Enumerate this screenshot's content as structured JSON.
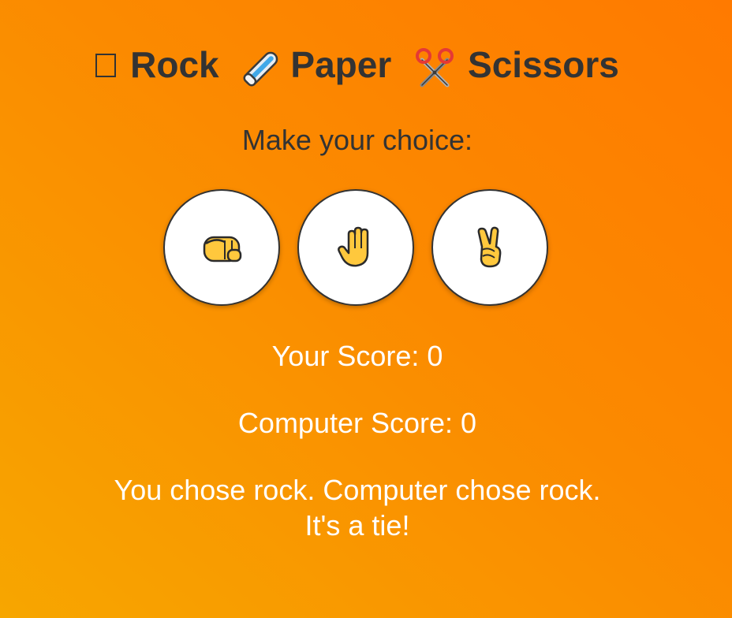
{
  "title": {
    "rock_label": "Rock",
    "paper_label": "Paper",
    "scissors_label": "Scissors",
    "rock_icon": "missing-glyph-box",
    "paper_icon": "paper-roll-icon",
    "scissors_icon": "scissors-icon"
  },
  "prompt": "Make your choice:",
  "choices": [
    {
      "id": "rock",
      "icon": "fist-icon"
    },
    {
      "id": "paper",
      "icon": "raised-hand-icon"
    },
    {
      "id": "scissors",
      "icon": "victory-hand-icon"
    }
  ],
  "scores": {
    "player_label": "Your Score: 0",
    "computer_label": "Computer Score: 0"
  },
  "result": {
    "line1": "You chose rock. Computer chose rock.",
    "line2": "It's a tie!"
  },
  "colors": {
    "background_start": "#f7a600",
    "background_end": "#ff7a00",
    "heading_text": "#333333",
    "score_text": "#ffffff",
    "button_fill": "#ffffff",
    "emoji_yellow": "#ffc83d"
  }
}
